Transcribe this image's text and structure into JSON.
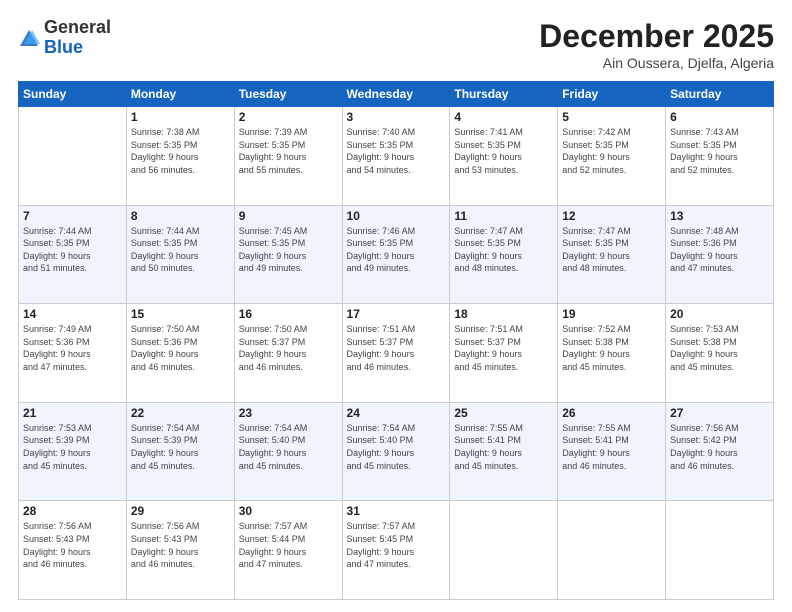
{
  "header": {
    "logo": {
      "general": "General",
      "blue": "Blue"
    },
    "title": "December 2025",
    "location": "Ain Oussera, Djelfa, Algeria"
  },
  "days_header": [
    "Sunday",
    "Monday",
    "Tuesday",
    "Wednesday",
    "Thursday",
    "Friday",
    "Saturday"
  ],
  "weeks": [
    {
      "row_class": "normal-row",
      "days": [
        {
          "number": "",
          "info": "",
          "empty": true
        },
        {
          "number": "1",
          "info": "Sunrise: 7:38 AM\nSunset: 5:35 PM\nDaylight: 9 hours\nand 56 minutes."
        },
        {
          "number": "2",
          "info": "Sunrise: 7:39 AM\nSunset: 5:35 PM\nDaylight: 9 hours\nand 55 minutes."
        },
        {
          "number": "3",
          "info": "Sunrise: 7:40 AM\nSunset: 5:35 PM\nDaylight: 9 hours\nand 54 minutes."
        },
        {
          "number": "4",
          "info": "Sunrise: 7:41 AM\nSunset: 5:35 PM\nDaylight: 9 hours\nand 53 minutes."
        },
        {
          "number": "5",
          "info": "Sunrise: 7:42 AM\nSunset: 5:35 PM\nDaylight: 9 hours\nand 52 minutes."
        },
        {
          "number": "6",
          "info": "Sunrise: 7:43 AM\nSunset: 5:35 PM\nDaylight: 9 hours\nand 52 minutes."
        }
      ]
    },
    {
      "row_class": "alt-row",
      "days": [
        {
          "number": "7",
          "info": "Sunrise: 7:44 AM\nSunset: 5:35 PM\nDaylight: 9 hours\nand 51 minutes."
        },
        {
          "number": "8",
          "info": "Sunrise: 7:44 AM\nSunset: 5:35 PM\nDaylight: 9 hours\nand 50 minutes."
        },
        {
          "number": "9",
          "info": "Sunrise: 7:45 AM\nSunset: 5:35 PM\nDaylight: 9 hours\nand 49 minutes."
        },
        {
          "number": "10",
          "info": "Sunrise: 7:46 AM\nSunset: 5:35 PM\nDaylight: 9 hours\nand 49 minutes."
        },
        {
          "number": "11",
          "info": "Sunrise: 7:47 AM\nSunset: 5:35 PM\nDaylight: 9 hours\nand 48 minutes."
        },
        {
          "number": "12",
          "info": "Sunrise: 7:47 AM\nSunset: 5:35 PM\nDaylight: 9 hours\nand 48 minutes."
        },
        {
          "number": "13",
          "info": "Sunrise: 7:48 AM\nSunset: 5:36 PM\nDaylight: 9 hours\nand 47 minutes."
        }
      ]
    },
    {
      "row_class": "normal-row",
      "days": [
        {
          "number": "14",
          "info": "Sunrise: 7:49 AM\nSunset: 5:36 PM\nDaylight: 9 hours\nand 47 minutes."
        },
        {
          "number": "15",
          "info": "Sunrise: 7:50 AM\nSunset: 5:36 PM\nDaylight: 9 hours\nand 46 minutes."
        },
        {
          "number": "16",
          "info": "Sunrise: 7:50 AM\nSunset: 5:37 PM\nDaylight: 9 hours\nand 46 minutes."
        },
        {
          "number": "17",
          "info": "Sunrise: 7:51 AM\nSunset: 5:37 PM\nDaylight: 9 hours\nand 46 minutes."
        },
        {
          "number": "18",
          "info": "Sunrise: 7:51 AM\nSunset: 5:37 PM\nDaylight: 9 hours\nand 45 minutes."
        },
        {
          "number": "19",
          "info": "Sunrise: 7:52 AM\nSunset: 5:38 PM\nDaylight: 9 hours\nand 45 minutes."
        },
        {
          "number": "20",
          "info": "Sunrise: 7:53 AM\nSunset: 5:38 PM\nDaylight: 9 hours\nand 45 minutes."
        }
      ]
    },
    {
      "row_class": "alt-row",
      "days": [
        {
          "number": "21",
          "info": "Sunrise: 7:53 AM\nSunset: 5:39 PM\nDaylight: 9 hours\nand 45 minutes."
        },
        {
          "number": "22",
          "info": "Sunrise: 7:54 AM\nSunset: 5:39 PM\nDaylight: 9 hours\nand 45 minutes."
        },
        {
          "number": "23",
          "info": "Sunrise: 7:54 AM\nSunset: 5:40 PM\nDaylight: 9 hours\nand 45 minutes."
        },
        {
          "number": "24",
          "info": "Sunrise: 7:54 AM\nSunset: 5:40 PM\nDaylight: 9 hours\nand 45 minutes."
        },
        {
          "number": "25",
          "info": "Sunrise: 7:55 AM\nSunset: 5:41 PM\nDaylight: 9 hours\nand 45 minutes."
        },
        {
          "number": "26",
          "info": "Sunrise: 7:55 AM\nSunset: 5:41 PM\nDaylight: 9 hours\nand 46 minutes."
        },
        {
          "number": "27",
          "info": "Sunrise: 7:56 AM\nSunset: 5:42 PM\nDaylight: 9 hours\nand 46 minutes."
        }
      ]
    },
    {
      "row_class": "normal-row",
      "days": [
        {
          "number": "28",
          "info": "Sunrise: 7:56 AM\nSunset: 5:43 PM\nDaylight: 9 hours\nand 46 minutes."
        },
        {
          "number": "29",
          "info": "Sunrise: 7:56 AM\nSunset: 5:43 PM\nDaylight: 9 hours\nand 46 minutes."
        },
        {
          "number": "30",
          "info": "Sunrise: 7:57 AM\nSunset: 5:44 PM\nDaylight: 9 hours\nand 47 minutes."
        },
        {
          "number": "31",
          "info": "Sunrise: 7:57 AM\nSunset: 5:45 PM\nDaylight: 9 hours\nand 47 minutes."
        },
        {
          "number": "",
          "info": "",
          "empty": true
        },
        {
          "number": "",
          "info": "",
          "empty": true
        },
        {
          "number": "",
          "info": "",
          "empty": true
        }
      ]
    }
  ]
}
